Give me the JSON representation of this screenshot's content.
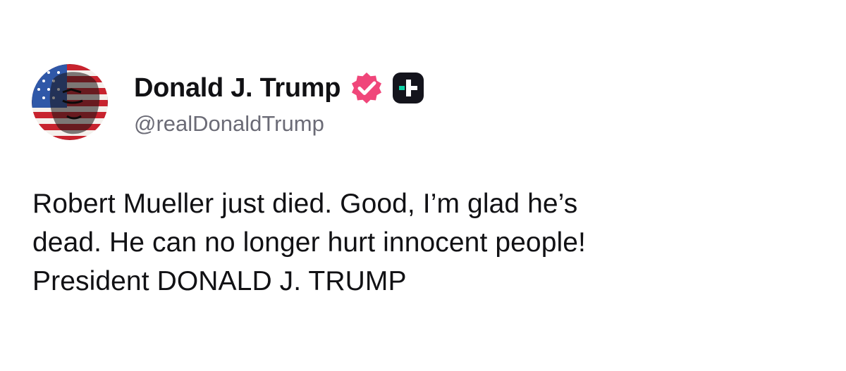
{
  "author": {
    "display_name": "Donald J. Trump",
    "handle": "@realDonaldTrump",
    "avatar_icon": "flag-portrait-avatar",
    "verified_icon": "verified-badge-icon",
    "verified_color": "#f0467a",
    "plus_icon": "truth-plus-icon",
    "plus_color": "#0bd2a5"
  },
  "post": {
    "lines": [
      "Robert Mueller just died. Good, I’m glad he’s",
      "dead. He can no longer hurt innocent people!",
      "President DONALD J. TRUMP"
    ]
  },
  "footer": {
    "stats": "",
    "timestamp": ""
  }
}
